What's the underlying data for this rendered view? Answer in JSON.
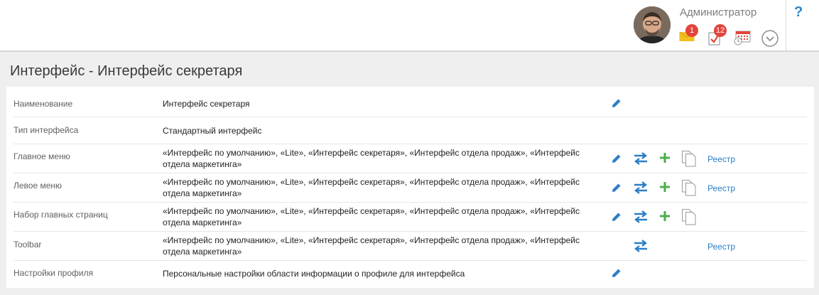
{
  "header": {
    "user_name": "Администратор",
    "messages_count": "1",
    "tasks_count": "12",
    "help_label": "?"
  },
  "page": {
    "title": "Интерфейс - Интерфейс секретаря"
  },
  "rows": [
    {
      "label": "Наименование",
      "value": "Интерфейс секретаря",
      "actions": [
        "edit"
      ]
    },
    {
      "label": "Тип интерфейса",
      "value": "Стандартный интерфейс",
      "actions": []
    },
    {
      "label": "Главное меню",
      "value": "«Интерфейс по умолчанию», «Lite», «Интерфейс секретаря», «Интерфейс отдела продаж», «Интерфейс отдела маркетинга»",
      "actions": [
        "edit",
        "swap",
        "add",
        "copy",
        "registry"
      ],
      "registry_label": "Реестр"
    },
    {
      "label": "Левое меню",
      "value": "«Интерфейс по умолчанию», «Lite», «Интерфейс секретаря», «Интерфейс отдела продаж», «Интерфейс отдела маркетинга»",
      "actions": [
        "edit",
        "swap",
        "add",
        "copy",
        "registry"
      ],
      "registry_label": "Реестр"
    },
    {
      "label": "Набор главных страниц",
      "value": "«Интерфейс по умолчанию», «Lite», «Интерфейс секретаря», «Интерфейс отдела продаж», «Интерфейс отдела маркетинга»",
      "actions": [
        "edit",
        "swap",
        "add",
        "copy"
      ]
    },
    {
      "label": "Toolbar",
      "value": "«Интерфейс по умолчанию», «Lite», «Интерфейс секретаря», «Интерфейс отдела продаж», «Интерфейс отдела маркетинга»",
      "actions": [
        "swap",
        "registry"
      ],
      "registry_label": "Реестр"
    },
    {
      "label": "Настройки профиля",
      "value": "Персональные настройки области информации о профиле для интерфейса",
      "actions": [
        "edit"
      ]
    }
  ],
  "colors": {
    "accent_blue": "#2b7ec7",
    "add_green": "#4cae4c",
    "badge_red": "#e2453c"
  },
  "icons": {
    "edit": "pencil-icon",
    "swap": "swap-arrows-icon",
    "add": "plus-icon",
    "copy": "copy-icon",
    "messages": "envelope-icon",
    "tasks": "task-check-icon",
    "calendar": "calendar-icon",
    "menu": "chevron-down-circle-icon"
  }
}
